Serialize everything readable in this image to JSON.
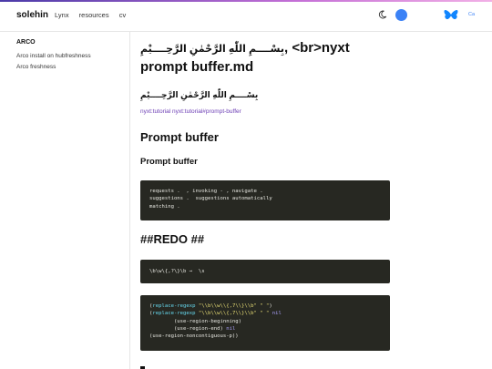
{
  "header": {
    "brand": "solehin",
    "nav": [
      "Lynx",
      "resources",
      "cv"
    ],
    "lang_label": "Ca"
  },
  "sidebar": {
    "title": "ARCO",
    "items": [
      "Arco install on hubfreshness",
      "Arco freshness"
    ]
  },
  "article": {
    "title_arabic": "بِسْــــمِ اللّٰهِ الرَّحْمٰنِ الرَّحِــــيْمِ",
    "title_text": "<br>nyxt prompt buffer.md",
    "bismillah": "بِسْــــمِ اللّٰهِ الرَّحْمٰنِ الرَّحِــــيْمِ",
    "tags": "nyxt:tutorial nyxt:tutorial#prompt-buffer",
    "heading_prompt": "Prompt buffer",
    "subheading_prompt": "Prompt buffer",
    "code1_lines": [
      "requests .  , invoking - , navigate .",
      "suggestions .  suggestions automatically",
      "matching ."
    ],
    "heading_redo": "##REDO ##",
    "code2_line": "\\b\\w\\{,?\\}\\b →  \\s",
    "code3_lines": [
      "(replace-regexp \"\\\\b\\\\w\\\\{,7\\\\}\\\\b\" \" \")",
      "(replace-regexp \"\\\\b\\\\w\\\\{,7\\\\}\\\\b\" \" \" nil",
      "        (use-region-beginning)",
      "        (use-region-end) nil",
      "(use-region-noncontiguous-p))"
    ]
  },
  "colors": {
    "code_bg": "#272822",
    "link": "#6d3fb5",
    "chat_button": "#3b82f6",
    "bluesky": "#1185fe"
  },
  "icons": {
    "theme_toggle": "moon-icon",
    "chat": "chat-bubble-icon",
    "social": "butterfly-icon"
  }
}
